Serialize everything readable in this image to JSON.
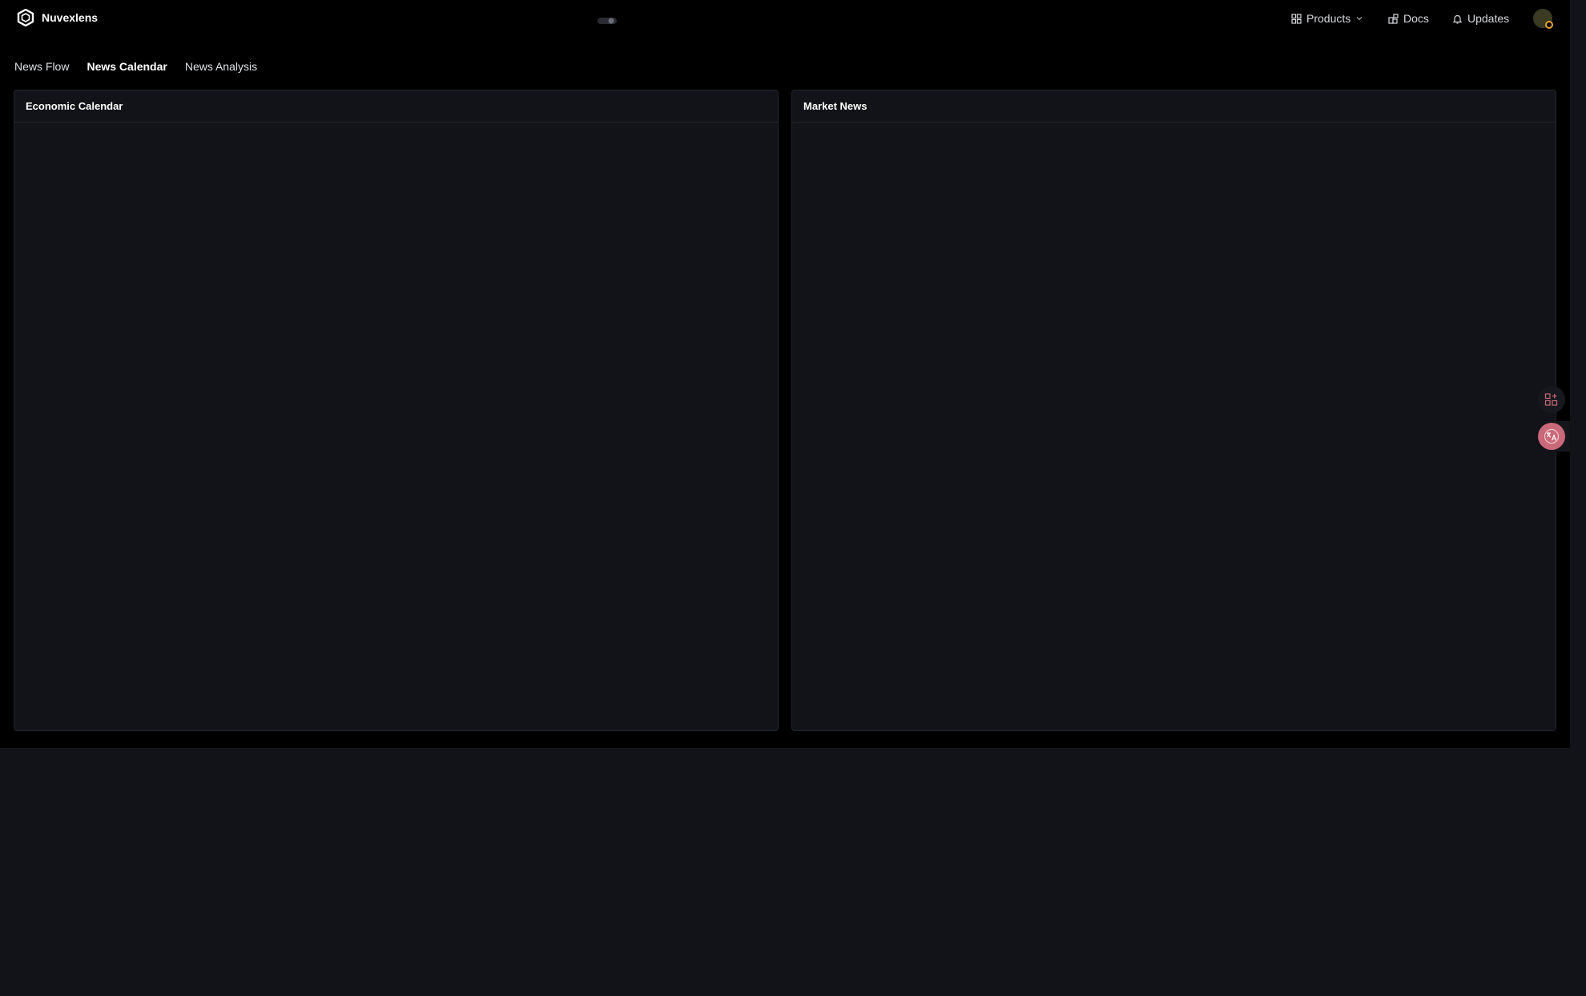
{
  "header": {
    "brand": "Nuvexlens",
    "nav": {
      "products": "Products",
      "docs": "Docs",
      "updates": "Updates"
    }
  },
  "tabs": [
    {
      "label": "News Flow",
      "active": false
    },
    {
      "label": "News Calendar",
      "active": true
    },
    {
      "label": "News Analysis",
      "active": false
    }
  ],
  "panels": {
    "left": {
      "title": "Economic Calendar"
    },
    "right": {
      "title": "Market News"
    }
  },
  "colors": {
    "background": "#000000",
    "panel": "#111318",
    "accent_pink": "#c9697a",
    "status_dot": "#e3a72f"
  }
}
